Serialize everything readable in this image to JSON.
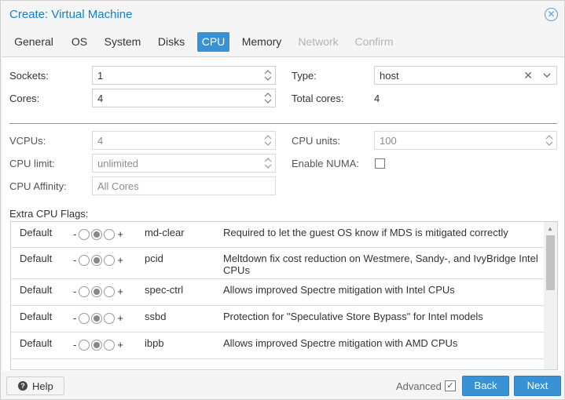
{
  "window": {
    "title": "Create: Virtual Machine"
  },
  "tabs": [
    {
      "label": "General",
      "state": "normal"
    },
    {
      "label": "OS",
      "state": "normal"
    },
    {
      "label": "System",
      "state": "normal"
    },
    {
      "label": "Disks",
      "state": "normal"
    },
    {
      "label": "CPU",
      "state": "active"
    },
    {
      "label": "Memory",
      "state": "normal"
    },
    {
      "label": "Network",
      "state": "disabled"
    },
    {
      "label": "Confirm",
      "state": "disabled"
    }
  ],
  "form": {
    "sockets": {
      "label": "Sockets:",
      "value": "1"
    },
    "cores": {
      "label": "Cores:",
      "value": "4"
    },
    "type": {
      "label": "Type:",
      "value": "host"
    },
    "total_cores": {
      "label": "Total cores:",
      "value": "4"
    },
    "vcpus": {
      "label": "VCPUs:",
      "value": "4"
    },
    "cpu_limit": {
      "label": "CPU limit:",
      "value": "unlimited"
    },
    "cpu_affinity": {
      "label": "CPU Affinity:",
      "placeholder": "All Cores"
    },
    "cpu_units": {
      "label": "CPU units:",
      "value": "100"
    },
    "enable_numa": {
      "label": "Enable NUMA:",
      "checked": false
    }
  },
  "extra_flags": {
    "label": "Extra CPU Flags:",
    "minus": "-",
    "plus": "+",
    "rows": [
      {
        "state": "Default",
        "flag": "md-clear",
        "description": "Required to let the guest OS know if MDS is mitigated correctly"
      },
      {
        "state": "Default",
        "flag": "pcid",
        "description": "Meltdown fix cost reduction on Westmere, Sandy-, and IvyBridge Intel CPUs"
      },
      {
        "state": "Default",
        "flag": "spec-ctrl",
        "description": "Allows improved Spectre mitigation with Intel CPUs"
      },
      {
        "state": "Default",
        "flag": "ssbd",
        "description": "Protection for \"Speculative Store Bypass\" for Intel models"
      },
      {
        "state": "Default",
        "flag": "ibpb",
        "description": "Allows improved Spectre mitigation with AMD CPUs"
      }
    ]
  },
  "footer": {
    "help": "Help",
    "advanced": "Advanced",
    "advanced_checked": true,
    "back": "Back",
    "next": "Next"
  },
  "colors": {
    "accent": "#3892d4",
    "title": "#157fcc"
  }
}
